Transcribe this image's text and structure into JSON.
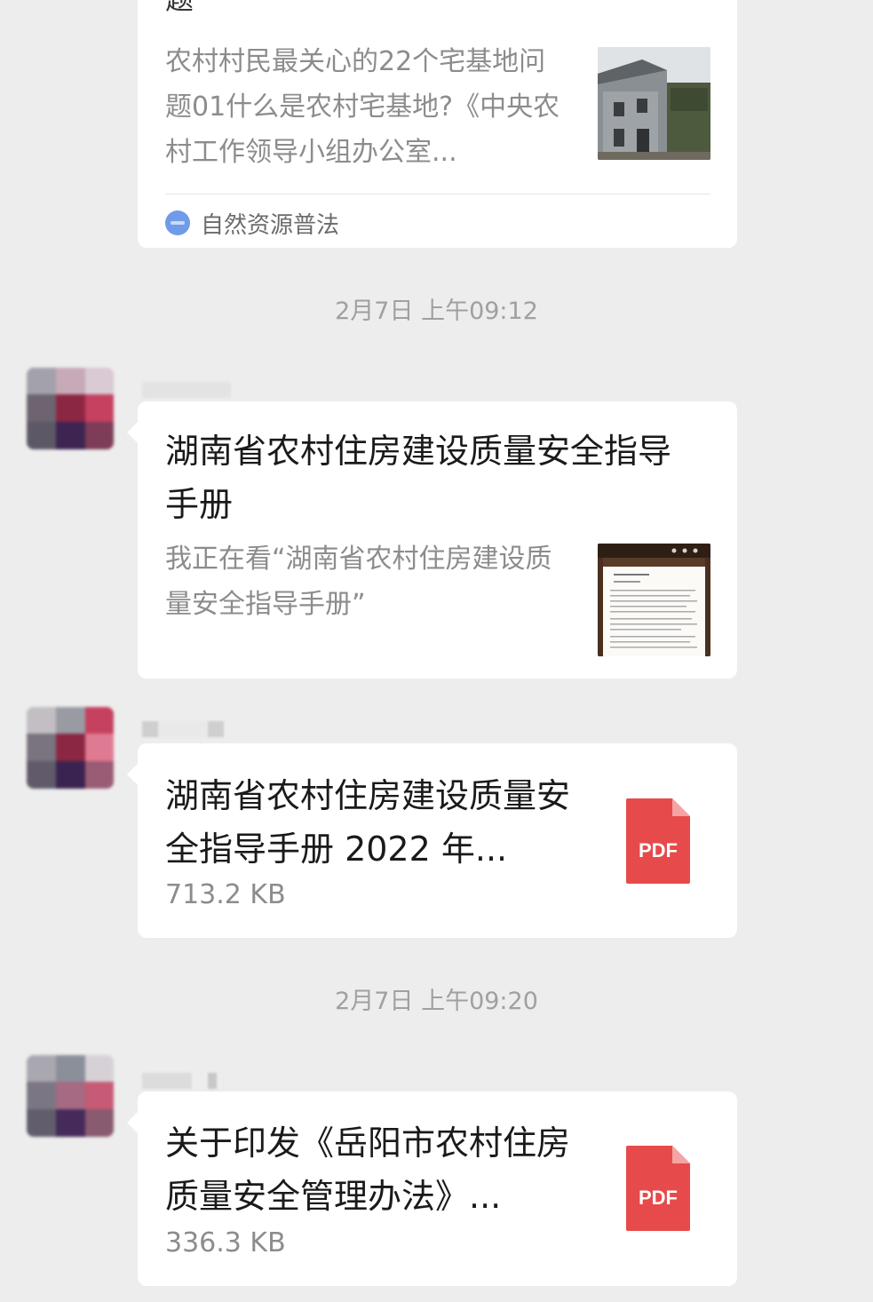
{
  "messages": [
    {
      "type": "article",
      "title_fragment": "题",
      "description": "农村村民最关心的22个宅基地问题01什么是农村宅基地?《中央农村工作领导小组办公室...",
      "thumbnail_icon": "rural-house-photo",
      "source": "自然资源普法",
      "source_icon": "source-logo-icon"
    },
    {
      "type": "timestamp",
      "text": "2月7日 上午09:12"
    },
    {
      "type": "article",
      "title": "湖南省农村住房建设质量安全指导手册",
      "description": "我正在看“湖南省农村住房建设质量安全指导手册”",
      "thumbnail_icon": "document-page-thumbnail"
    },
    {
      "type": "file",
      "title": "湖南省农村住房建设质量安全指导手册 2022 年...",
      "size": "713.2 KB",
      "icon_label": "PDF",
      "icon_color": "#e74a4a"
    },
    {
      "type": "timestamp",
      "text": "2月7日 上午09:20"
    },
    {
      "type": "file",
      "title": "关于印发《岳阳市农村住房质量安全管理办法》...",
      "size": "336.3 KB",
      "icon_label": "PDF",
      "icon_color": "#e74a4a"
    }
  ],
  "colors": {
    "background": "#ededed",
    "bubble": "#ffffff",
    "pdf": "#e74a4a",
    "source_icon": "#6f9be8"
  }
}
